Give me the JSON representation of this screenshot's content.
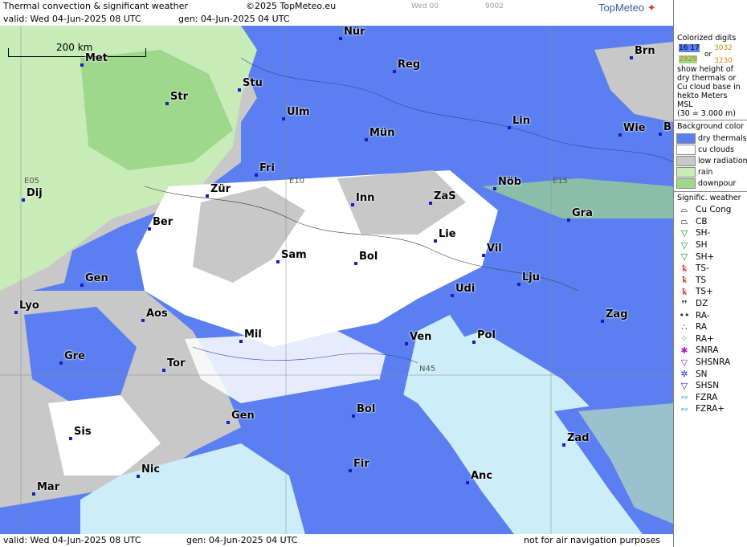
{
  "header": {
    "title": "Thermal convection & significant weather",
    "copyright": "©2025 TopMeteo.eu",
    "valid": "valid:  Wed  04-Jun-2025  08 UTC",
    "generated": "gen: 04-Jun-2025 04 UTC",
    "faint_1": "Wed 00",
    "faint_2": "9002",
    "logo": "TopMeteo"
  },
  "footer": {
    "valid": "valid:  Wed  04-Jun-2025  08 UTC",
    "generated": "gen: 04-Jun-2025 04 UTC",
    "disclaimer": "not for air navigation purposes"
  },
  "map": {
    "scale_label": "200 km",
    "grid_labels": [
      "E05",
      "E10",
      "E15",
      "N45"
    ],
    "cities": [
      "Nür",
      "Reg",
      "Brn",
      "Met",
      "Stu",
      "Str",
      "Ulm",
      "Mün",
      "Lin",
      "Wie",
      "B",
      "Fri",
      "Dij",
      "Zür",
      "Inn",
      "ZaS",
      "Nöb",
      "Gra",
      "Ber",
      "Lie",
      "Vil",
      "Sam",
      "Bol",
      "Gen",
      "Lju",
      "Udi",
      "Lyo",
      "Aos",
      "Zag",
      "Mil",
      "Ven",
      "Pol",
      "Gre",
      "Tor",
      "Gen",
      "Bol",
      "Sis",
      "Zad",
      "Fir",
      "Nic",
      "Mar",
      "Anc"
    ],
    "colors": {
      "dry_thermals": "#5b7ff0",
      "cu_clouds": "#ffffff",
      "low_radiation": "#c8c8c8",
      "rain": "#c8ecb8",
      "downpour": "#9fd88a",
      "sea": "#cdeef8",
      "city_dot": "#1a1acc"
    }
  },
  "legend": {
    "colorized_title": "Colorized digits",
    "example_a": "16 17",
    "example_b": "3032",
    "example_or": "or",
    "example_c": "2829",
    "example_d": "3230",
    "description": "show height of dry thermals or Cu cloud base in hekto Meters MSL",
    "example_note": "(30 = 3.000 m)",
    "background_title": "Background color",
    "background_items": [
      "dry thermals",
      "cu clouds",
      "low radiation",
      "rain",
      "downpour"
    ],
    "weather_title": "Signific. weather",
    "weather_items": [
      {
        "code": "Cu Cong",
        "icon": "cumulus-congestus-icon",
        "glyph": "⌓"
      },
      {
        "code": "CB",
        "icon": "cumulonimbus-icon",
        "glyph": "⏢"
      },
      {
        "code": "SH-",
        "icon": "light-shower-icon",
        "glyph": "▽"
      },
      {
        "code": "SH",
        "icon": "shower-icon",
        "glyph": "▽"
      },
      {
        "code": "SH+",
        "icon": "heavy-shower-icon",
        "glyph": "▽"
      },
      {
        "code": "TS-",
        "icon": "light-thunderstorm-icon",
        "glyph": "ꝅ"
      },
      {
        "code": "TS",
        "icon": "thunderstorm-icon",
        "glyph": "ꝅ"
      },
      {
        "code": "TS+",
        "icon": "heavy-thunderstorm-icon",
        "glyph": "ꝅ"
      },
      {
        "code": "DZ",
        "icon": "drizzle-icon",
        "glyph": "❜❜"
      },
      {
        "code": "RA-",
        "icon": "light-rain-icon",
        "glyph": "••"
      },
      {
        "code": "RA",
        "icon": "rain-icon",
        "glyph": "∴"
      },
      {
        "code": "RA+",
        "icon": "heavy-rain-icon",
        "glyph": "⁘"
      },
      {
        "code": "SNRA",
        "icon": "sleet-icon",
        "glyph": "✱"
      },
      {
        "code": "SHSNRA",
        "icon": "sleet-shower-icon",
        "glyph": "▽"
      },
      {
        "code": "SN",
        "icon": "snow-icon",
        "glyph": "✲"
      },
      {
        "code": "SHSN",
        "icon": "snow-shower-icon",
        "glyph": "▽"
      },
      {
        "code": "FZRA",
        "icon": "freezing-rain-icon",
        "glyph": "∾"
      },
      {
        "code": "FZRA+",
        "icon": "heavy-freezing-rain-icon",
        "glyph": "∾"
      }
    ]
  }
}
